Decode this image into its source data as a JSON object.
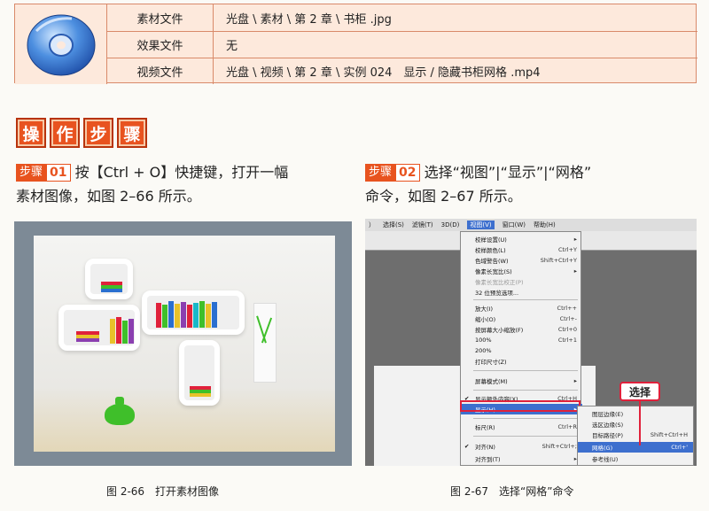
{
  "resources": {
    "rows": [
      {
        "label": "素材文件",
        "value": "光盘 \\ 素材 \\ 第 2 章 \\ 书柜 .jpg"
      },
      {
        "label": "效果文件",
        "value": "无"
      },
      {
        "label": "视频文件",
        "value": "光盘 \\ 视频 \\ 第 2 章 \\ 实例 024　显示 / 隐藏书柜网格 .mp4"
      }
    ]
  },
  "section_title": [
    "操",
    "作",
    "步",
    "骤"
  ],
  "step1": {
    "badge": "步骤",
    "num": "01",
    "line1": "按【Ctrl + O】快捷键，打开一幅",
    "line2": "素材图像，如图 2–66 所示。"
  },
  "step2": {
    "badge": "步骤",
    "num": "02",
    "line1": "选择“视图”|“显示”|“网格”",
    "line2": "命令，如图 2–67 所示。"
  },
  "screenshot": {
    "menubar": [
      "）",
      "选择(S)",
      "滤镜(T)",
      "3D(D)",
      "视图(V)",
      "窗口(W)",
      "帮助(H)"
    ],
    "view_menu": [
      {
        "label": "校样设置(U)",
        "shortcut": ""
      },
      {
        "label": "校样颜色(L)",
        "shortcut": "Ctrl+Y"
      },
      {
        "label": "色域警告(W)",
        "shortcut": "Shift+Ctrl+Y"
      },
      {
        "label": "像素长宽比(S)",
        "shortcut": ""
      },
      {
        "label": "像素长宽比校正(P)",
        "shortcut": ""
      },
      {
        "label": "32 位预览选项...",
        "shortcut": ""
      },
      {
        "label": "放大(I)",
        "shortcut": "Ctrl++"
      },
      {
        "label": "缩小(O)",
        "shortcut": "Ctrl+-"
      },
      {
        "label": "按屏幕大小缩放(F)",
        "shortcut": "Ctrl+0"
      },
      {
        "label": "100%",
        "shortcut": "Ctrl+1"
      },
      {
        "label": "200%",
        "shortcut": ""
      },
      {
        "label": "打印尺寸(Z)",
        "shortcut": ""
      },
      {
        "label": "屏幕模式(M)",
        "shortcut": ""
      },
      {
        "label": "显示额外内容(X)",
        "shortcut": "Ctrl+H"
      },
      {
        "label": "显示(H)",
        "shortcut": ""
      },
      {
        "label": "标尺(R)",
        "shortcut": "Ctrl+R"
      },
      {
        "label": "对齐(N)",
        "shortcut": "Shift+Ctrl+;"
      },
      {
        "label": "对齐到(T)",
        "shortcut": ""
      }
    ],
    "show_submenu": [
      {
        "label": "图层边缘(E)",
        "shortcut": ""
      },
      {
        "label": "选区边缘(S)",
        "shortcut": ""
      },
      {
        "label": "目标路径(P)",
        "shortcut": "Shift+Ctrl+H"
      },
      {
        "label": "网格(G)",
        "shortcut": "Ctrl+'"
      },
      {
        "label": "参考线(U)",
        "shortcut": ""
      }
    ],
    "callout": "选择"
  },
  "captions": {
    "left": "图 2-66　打开素材图像",
    "right": "图 2-67　选择“网格”命令"
  },
  "colors": {
    "accent": "#e8531f",
    "table_bg": "#fde9dc",
    "highlight": "#3d6fce",
    "callout": "#e0213b"
  }
}
